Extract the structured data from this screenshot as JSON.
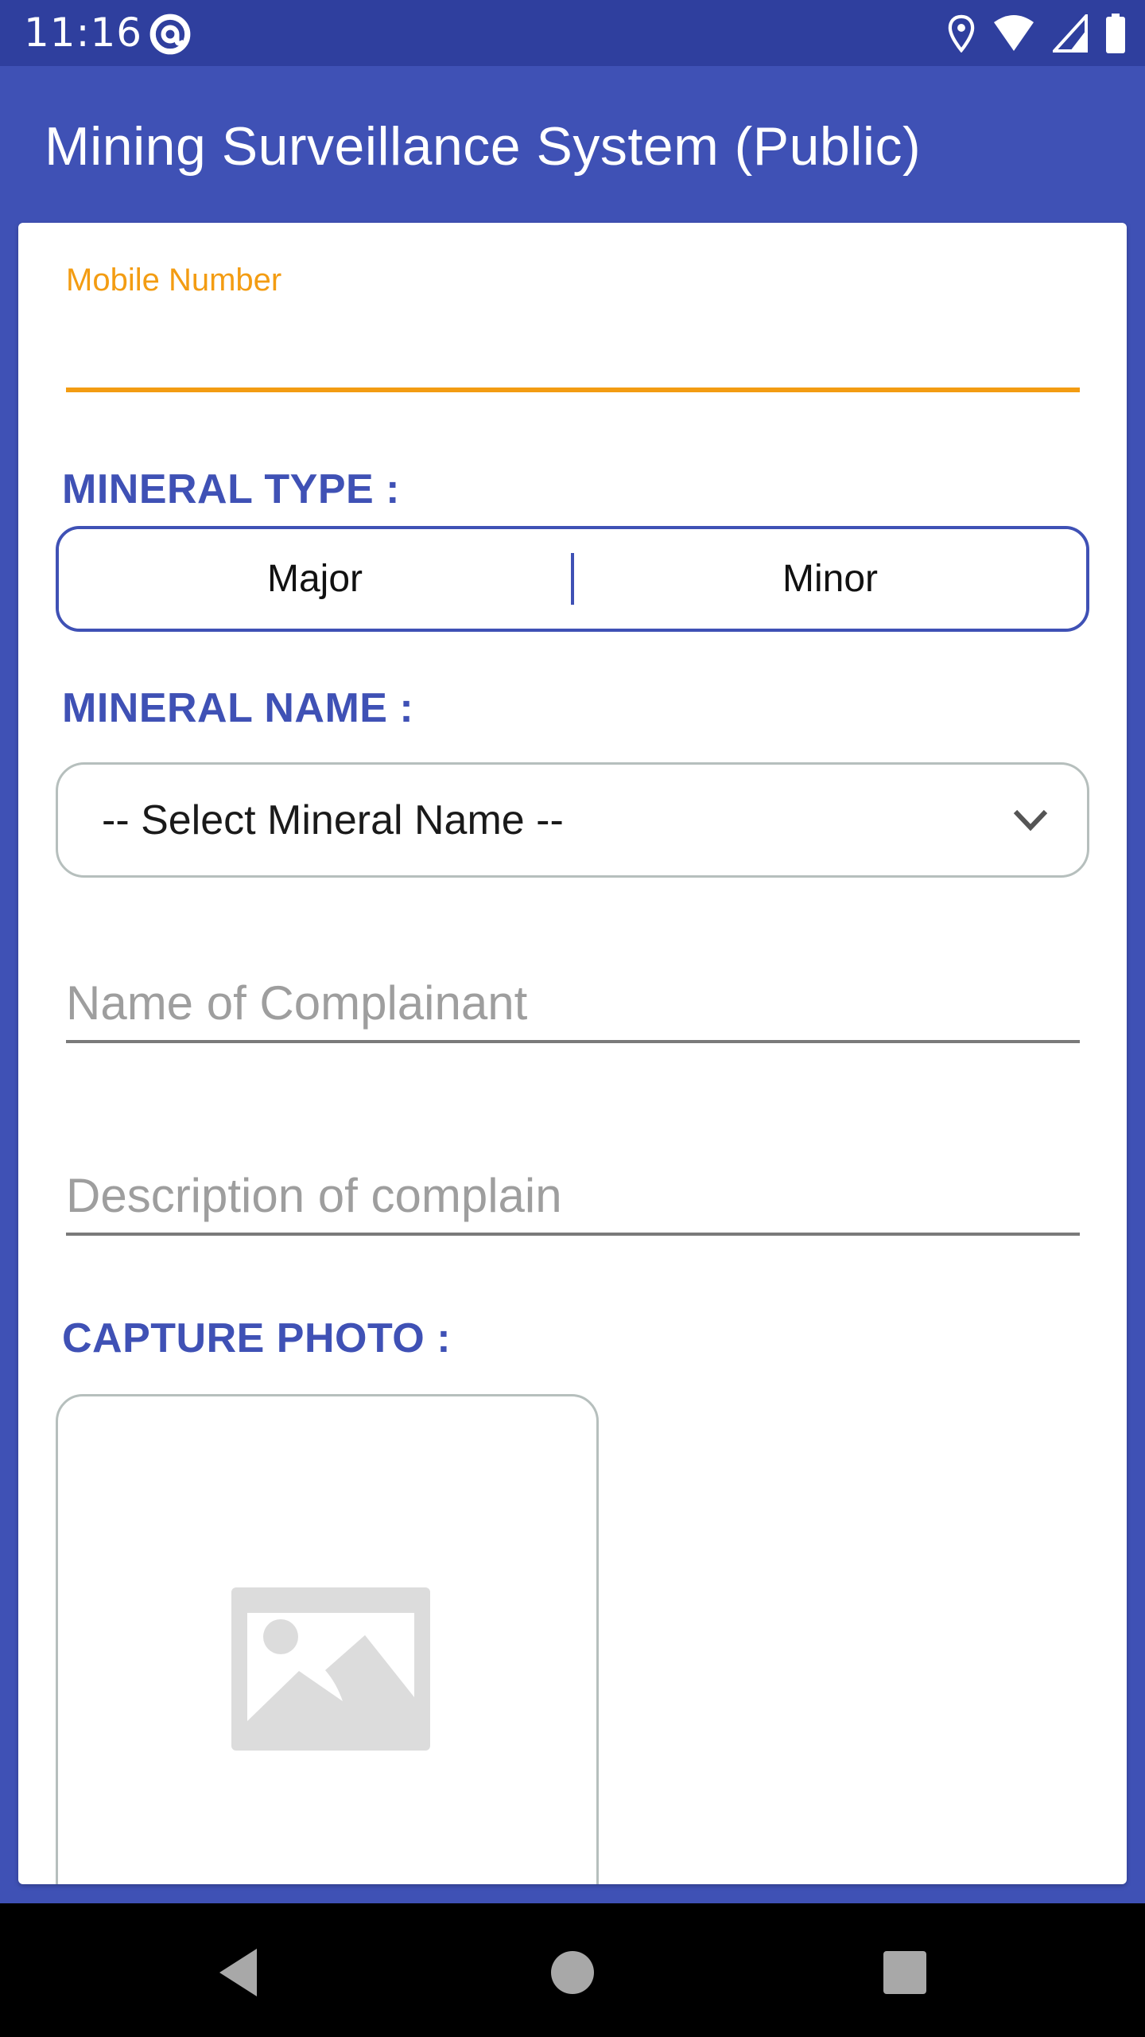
{
  "status_bar": {
    "time": "11:16",
    "icons": [
      "at-sign-icon",
      "location-icon",
      "wifi-icon",
      "signal-icon",
      "battery-icon"
    ]
  },
  "app_bar": {
    "title": "Mining Surveillance System (Public)"
  },
  "form": {
    "mobile_number": {
      "label": "Mobile Number",
      "value": ""
    },
    "mineral_type": {
      "label": "MINERAL TYPE :",
      "options": [
        "Major",
        "Minor"
      ]
    },
    "mineral_name": {
      "label": "MINERAL NAME :",
      "selected": "-- Select Mineral Name --"
    },
    "complainant_name": {
      "placeholder": "Name of Complainant",
      "value": ""
    },
    "description": {
      "placeholder": "Description of complain",
      "value": ""
    },
    "capture_photo": {
      "label": "CAPTURE PHOTO :",
      "icon": "image-placeholder-icon"
    }
  },
  "nav_bar": {
    "buttons": [
      "back",
      "home",
      "recents"
    ]
  },
  "colors": {
    "primary": "#3F51B5",
    "primary_dark": "#2F3F9E",
    "accent": "#F39C12",
    "border_gray": "#B6BFBD"
  }
}
